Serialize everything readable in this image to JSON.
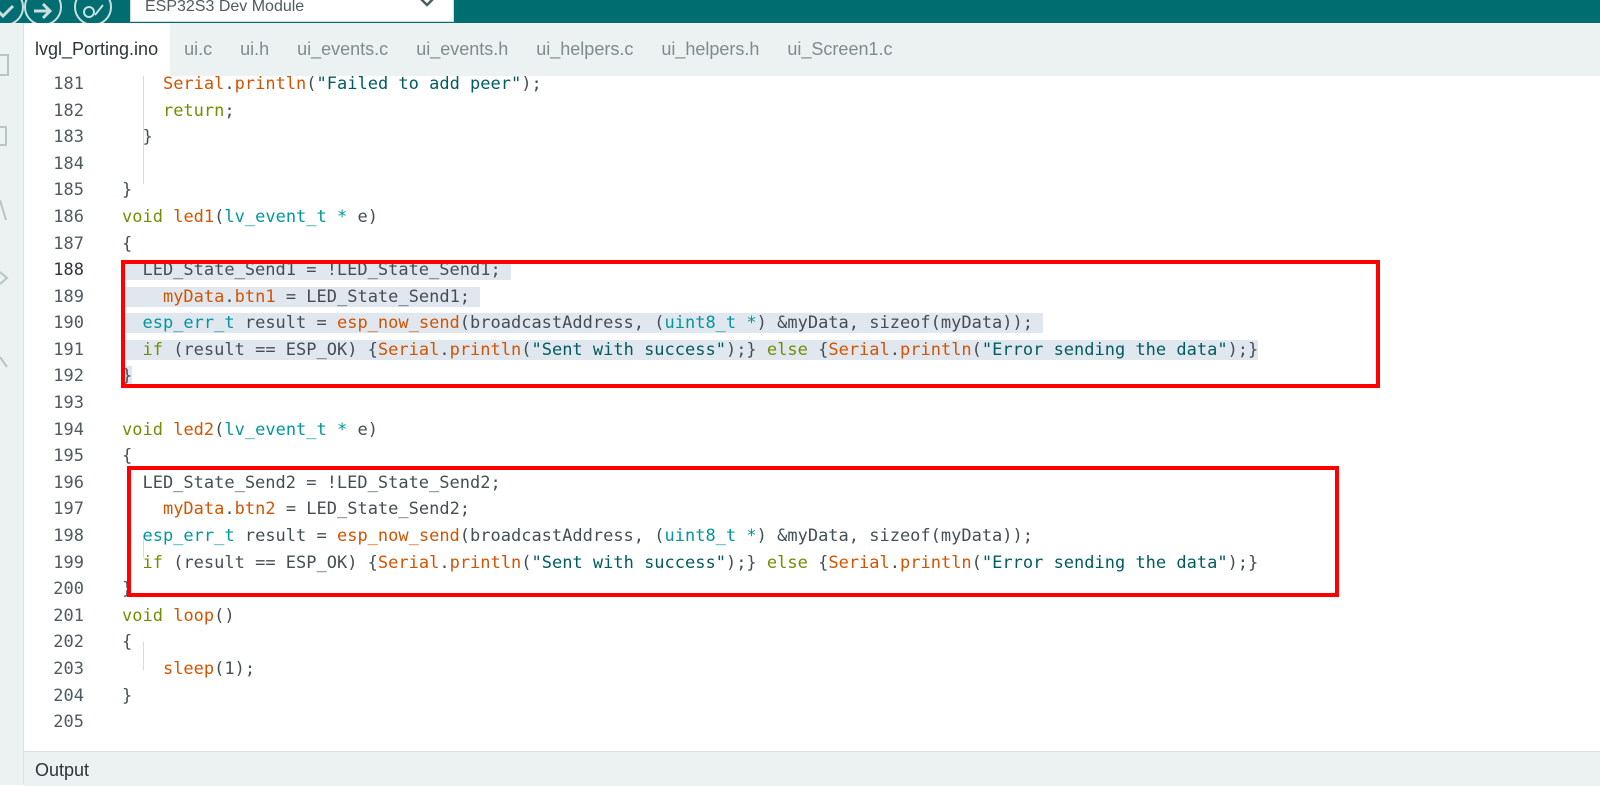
{
  "toolbar": {
    "verify_icon": "verify-check-icon",
    "upload_icon": "upload-arrow-icon",
    "debug_icon": "debug-icon",
    "board": "ESP32S3 Dev Module"
  },
  "tabs": [
    {
      "label": "lvgl_Porting.ino",
      "active": true
    },
    {
      "label": "ui.c"
    },
    {
      "label": "ui.h"
    },
    {
      "label": "ui_events.c"
    },
    {
      "label": "ui_events.h"
    },
    {
      "label": "ui_helpers.c"
    },
    {
      "label": "ui_helpers.h"
    },
    {
      "label": "ui_Screen1.c"
    }
  ],
  "editor": {
    "current_line": 188,
    "lines": [
      {
        "n": "181",
        "code": "    Serial.println(\"Failed to add peer\");"
      },
      {
        "n": "182",
        "code": "    return;"
      },
      {
        "n": "183",
        "code": "  }"
      },
      {
        "n": "184",
        "code": ""
      },
      {
        "n": "185",
        "code": "}"
      },
      {
        "n": "186",
        "code": "void led1(lv_event_t * e)"
      },
      {
        "n": "187",
        "code": "{"
      },
      {
        "n": "188",
        "code": "  LED_State_Send1 = !LED_State_Send1;"
      },
      {
        "n": "189",
        "code": "    myData.btn1 = LED_State_Send1;"
      },
      {
        "n": "190",
        "code": "  esp_err_t result = esp_now_send(broadcastAddress, (uint8_t *) &myData, sizeof(myData));"
      },
      {
        "n": "191",
        "code": "  if (result == ESP_OK) {Serial.println(\"Sent with success\");} else {Serial.println(\"Error sending the data\");}"
      },
      {
        "n": "192",
        "code": "}"
      },
      {
        "n": "193",
        "code": ""
      },
      {
        "n": "194",
        "code": "void led2(lv_event_t * e)"
      },
      {
        "n": "195",
        "code": "{"
      },
      {
        "n": "196",
        "code": "  LED_State_Send2 = !LED_State_Send2;"
      },
      {
        "n": "197",
        "code": "    myData.btn2 = LED_State_Send2;"
      },
      {
        "n": "198",
        "code": "  esp_err_t result = esp_now_send(broadcastAddress, (uint8_t *) &myData, sizeof(myData));"
      },
      {
        "n": "199",
        "code": "  if (result == ESP_OK) {Serial.println(\"Sent with success\");} else {Serial.println(\"Error sending the data\");}"
      },
      {
        "n": "200",
        "code": "}"
      },
      {
        "n": "201",
        "code": "void loop()"
      },
      {
        "n": "202",
        "code": "{"
      },
      {
        "n": "203",
        "code": "    sleep(1);"
      },
      {
        "n": "204",
        "code": "}"
      },
      {
        "n": "205",
        "code": ""
      }
    ]
  },
  "output": {
    "label": "Output"
  },
  "colors": {
    "toolbar": "#006d70",
    "highlight_box": "#ff0000",
    "selection": "#e1e7ee"
  }
}
